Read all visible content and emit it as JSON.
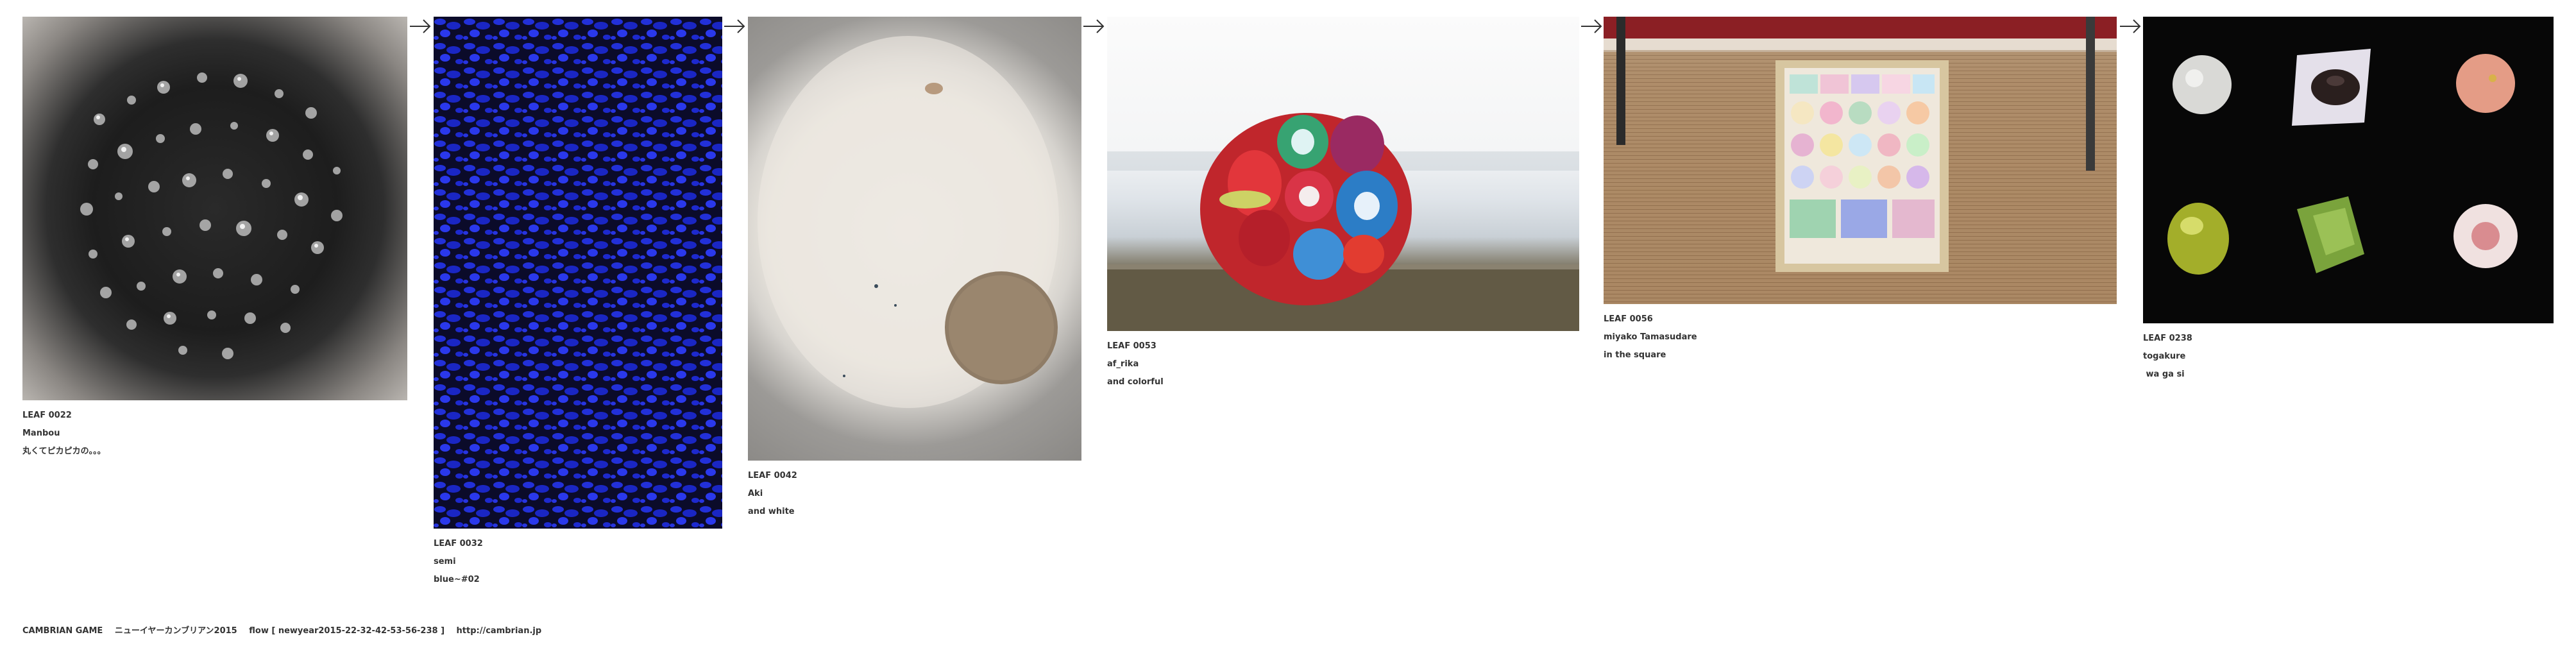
{
  "leaves": [
    {
      "code": "LEAF 0022",
      "title": "Manbou",
      "note": "丸くてピカピカの。。。"
    },
    {
      "code": "LEAF 0032",
      "title": "semi",
      "note": "blue~#02"
    },
    {
      "code": "LEAF 0042",
      "title": "Aki",
      "note": "and white"
    },
    {
      "code": "LEAF 0053",
      "title": "af_rika",
      "note": "and colorful"
    },
    {
      "code": "LEAF 0056",
      "title": "miyako Tamasudare",
      "note": "in the square"
    },
    {
      "code": "LEAF 0238",
      "title": "togakure",
      "note": " wa ga si"
    }
  ],
  "arrow_icon": "arrow-right-icon",
  "footer": {
    "brand": "CAMBRIAN GAME",
    "series": "ニューイヤーカンブリアン2015",
    "flow": "flow [ newyear2015-22-32-42-53-56-238 ]",
    "url": "http://cambrian.jp"
  },
  "colors": {
    "text": "#333333",
    "background": "#ffffff",
    "blue_accent": "#1f2bd6"
  }
}
